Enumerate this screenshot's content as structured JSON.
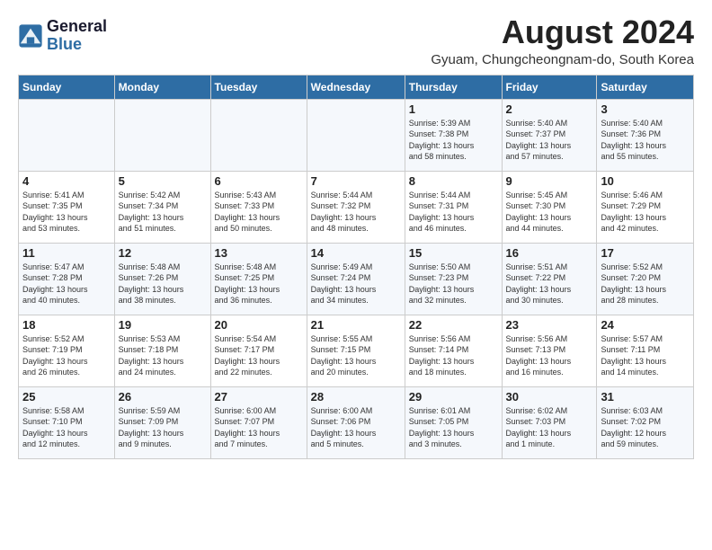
{
  "logo": {
    "line1": "General",
    "line2": "Blue"
  },
  "title": "August 2024",
  "location": "Gyuam, Chungcheongnam-do, South Korea",
  "days_of_week": [
    "Sunday",
    "Monday",
    "Tuesday",
    "Wednesday",
    "Thursday",
    "Friday",
    "Saturday"
  ],
  "weeks": [
    [
      {
        "day": "",
        "info": ""
      },
      {
        "day": "",
        "info": ""
      },
      {
        "day": "",
        "info": ""
      },
      {
        "day": "",
        "info": ""
      },
      {
        "day": "1",
        "info": "Sunrise: 5:39 AM\nSunset: 7:38 PM\nDaylight: 13 hours\nand 58 minutes."
      },
      {
        "day": "2",
        "info": "Sunrise: 5:40 AM\nSunset: 7:37 PM\nDaylight: 13 hours\nand 57 minutes."
      },
      {
        "day": "3",
        "info": "Sunrise: 5:40 AM\nSunset: 7:36 PM\nDaylight: 13 hours\nand 55 minutes."
      }
    ],
    [
      {
        "day": "4",
        "info": "Sunrise: 5:41 AM\nSunset: 7:35 PM\nDaylight: 13 hours\nand 53 minutes."
      },
      {
        "day": "5",
        "info": "Sunrise: 5:42 AM\nSunset: 7:34 PM\nDaylight: 13 hours\nand 51 minutes."
      },
      {
        "day": "6",
        "info": "Sunrise: 5:43 AM\nSunset: 7:33 PM\nDaylight: 13 hours\nand 50 minutes."
      },
      {
        "day": "7",
        "info": "Sunrise: 5:44 AM\nSunset: 7:32 PM\nDaylight: 13 hours\nand 48 minutes."
      },
      {
        "day": "8",
        "info": "Sunrise: 5:44 AM\nSunset: 7:31 PM\nDaylight: 13 hours\nand 46 minutes."
      },
      {
        "day": "9",
        "info": "Sunrise: 5:45 AM\nSunset: 7:30 PM\nDaylight: 13 hours\nand 44 minutes."
      },
      {
        "day": "10",
        "info": "Sunrise: 5:46 AM\nSunset: 7:29 PM\nDaylight: 13 hours\nand 42 minutes."
      }
    ],
    [
      {
        "day": "11",
        "info": "Sunrise: 5:47 AM\nSunset: 7:28 PM\nDaylight: 13 hours\nand 40 minutes."
      },
      {
        "day": "12",
        "info": "Sunrise: 5:48 AM\nSunset: 7:26 PM\nDaylight: 13 hours\nand 38 minutes."
      },
      {
        "day": "13",
        "info": "Sunrise: 5:48 AM\nSunset: 7:25 PM\nDaylight: 13 hours\nand 36 minutes."
      },
      {
        "day": "14",
        "info": "Sunrise: 5:49 AM\nSunset: 7:24 PM\nDaylight: 13 hours\nand 34 minutes."
      },
      {
        "day": "15",
        "info": "Sunrise: 5:50 AM\nSunset: 7:23 PM\nDaylight: 13 hours\nand 32 minutes."
      },
      {
        "day": "16",
        "info": "Sunrise: 5:51 AM\nSunset: 7:22 PM\nDaylight: 13 hours\nand 30 minutes."
      },
      {
        "day": "17",
        "info": "Sunrise: 5:52 AM\nSunset: 7:20 PM\nDaylight: 13 hours\nand 28 minutes."
      }
    ],
    [
      {
        "day": "18",
        "info": "Sunrise: 5:52 AM\nSunset: 7:19 PM\nDaylight: 13 hours\nand 26 minutes."
      },
      {
        "day": "19",
        "info": "Sunrise: 5:53 AM\nSunset: 7:18 PM\nDaylight: 13 hours\nand 24 minutes."
      },
      {
        "day": "20",
        "info": "Sunrise: 5:54 AM\nSunset: 7:17 PM\nDaylight: 13 hours\nand 22 minutes."
      },
      {
        "day": "21",
        "info": "Sunrise: 5:55 AM\nSunset: 7:15 PM\nDaylight: 13 hours\nand 20 minutes."
      },
      {
        "day": "22",
        "info": "Sunrise: 5:56 AM\nSunset: 7:14 PM\nDaylight: 13 hours\nand 18 minutes."
      },
      {
        "day": "23",
        "info": "Sunrise: 5:56 AM\nSunset: 7:13 PM\nDaylight: 13 hours\nand 16 minutes."
      },
      {
        "day": "24",
        "info": "Sunrise: 5:57 AM\nSunset: 7:11 PM\nDaylight: 13 hours\nand 14 minutes."
      }
    ],
    [
      {
        "day": "25",
        "info": "Sunrise: 5:58 AM\nSunset: 7:10 PM\nDaylight: 13 hours\nand 12 minutes."
      },
      {
        "day": "26",
        "info": "Sunrise: 5:59 AM\nSunset: 7:09 PM\nDaylight: 13 hours\nand 9 minutes."
      },
      {
        "day": "27",
        "info": "Sunrise: 6:00 AM\nSunset: 7:07 PM\nDaylight: 13 hours\nand 7 minutes."
      },
      {
        "day": "28",
        "info": "Sunrise: 6:00 AM\nSunset: 7:06 PM\nDaylight: 13 hours\nand 5 minutes."
      },
      {
        "day": "29",
        "info": "Sunrise: 6:01 AM\nSunset: 7:05 PM\nDaylight: 13 hours\nand 3 minutes."
      },
      {
        "day": "30",
        "info": "Sunrise: 6:02 AM\nSunset: 7:03 PM\nDaylight: 13 hours\nand 1 minute."
      },
      {
        "day": "31",
        "info": "Sunrise: 6:03 AM\nSunset: 7:02 PM\nDaylight: 12 hours\nand 59 minutes."
      }
    ]
  ]
}
